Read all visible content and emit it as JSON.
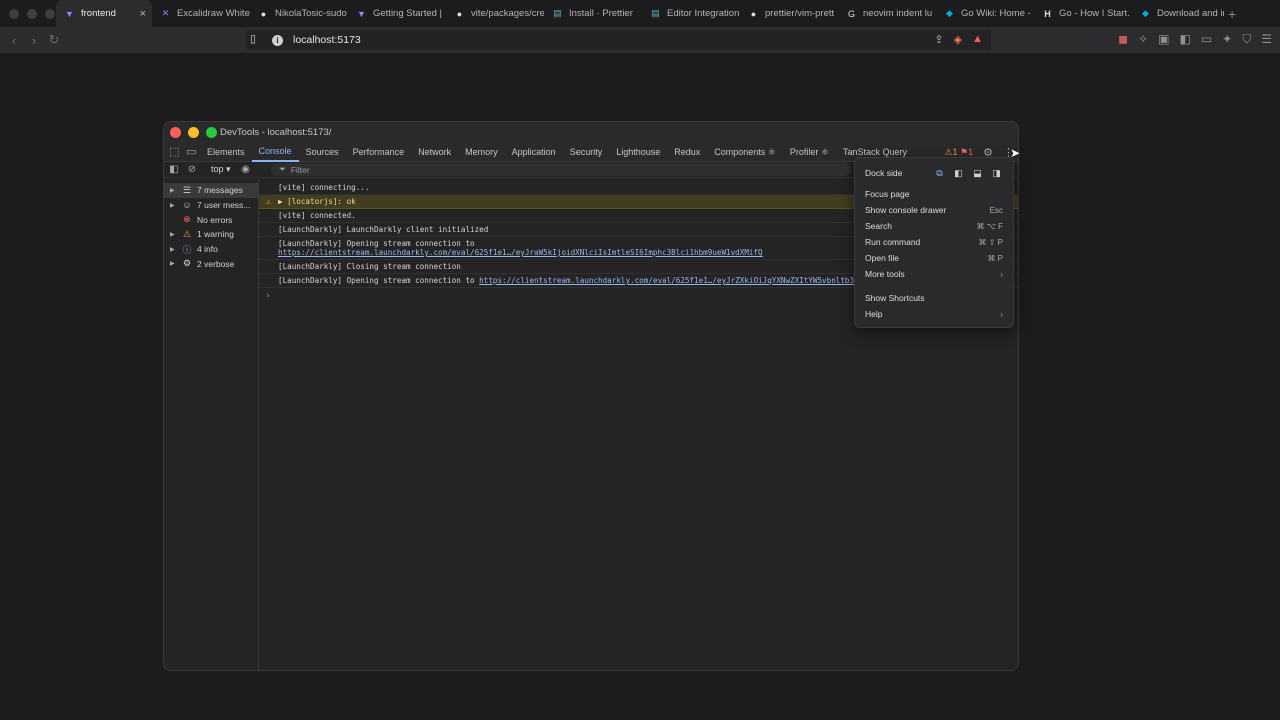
{
  "browser": {
    "tabs": [
      {
        "label": "frontend",
        "icon": "vite-icon",
        "active": true
      },
      {
        "label": "Excalidraw White",
        "icon": "excalidraw-icon"
      },
      {
        "label": "NikolaTosic-sudo",
        "icon": "github-icon"
      },
      {
        "label": "Getting Started |",
        "icon": "vite-icon"
      },
      {
        "label": "vite/packages/cre",
        "icon": "github-icon"
      },
      {
        "label": "Install · Prettier",
        "icon": "prettier-icon"
      },
      {
        "label": "Editor Integration",
        "icon": "prettier-icon"
      },
      {
        "label": "prettier/vim-prett",
        "icon": "github-icon"
      },
      {
        "label": "neovim indent lu",
        "icon": "google-icon"
      },
      {
        "label": "Go Wiki: Home -",
        "icon": "go-icon"
      },
      {
        "label": "Go - How I Start.",
        "icon": "h-icon"
      },
      {
        "label": "Download and in",
        "icon": "go-icon"
      }
    ],
    "url": "localhost:5173"
  },
  "devtools": {
    "title": "DevTools - localhost:5173/",
    "tabs": [
      "Elements",
      "Console",
      "Sources",
      "Performance",
      "Network",
      "Memory",
      "Application",
      "Security",
      "Lighthouse",
      "Redux",
      "Components ⚛",
      "Profiler ⚛",
      "TanStack Query"
    ],
    "active_tab": "Console",
    "warning_count": "1",
    "issue_count": "1",
    "context": "top",
    "filter_placeholder": "Filter",
    "sidebar": [
      {
        "label": "7 messages",
        "icon": "list-icon"
      },
      {
        "label": "7 user mess...",
        "icon": "user-icon"
      },
      {
        "label": "No errors",
        "icon": "error-icon"
      },
      {
        "label": "1 warning",
        "icon": "warning-icon"
      },
      {
        "label": "4 info",
        "icon": "info-icon"
      },
      {
        "label": "2 verbose",
        "icon": "verbose-icon"
      }
    ],
    "messages": [
      {
        "text": "[vite] connecting..."
      },
      {
        "text": "▶ [locatorjs]: ok",
        "level": "warn"
      },
      {
        "text": "[vite] connected."
      },
      {
        "text": "[LaunchDarkly] LaunchDarkly client initialized"
      },
      {
        "text": "[LaunchDarkly] Opening stream connection to",
        "link": "https://clientstream.launchdarkly.com/eval/625f1e1…/eyJraW5kIjoidXNlciIsImtleSI6Imphc3Blci1hbm9ueW1vdXMifQ"
      },
      {
        "text": "[LaunchDarkly] Closing stream connection"
      },
      {
        "text": "[LaunchDarkly] Opening stream connection to ",
        "link_inline": "https://clientstream.launchdarkly.com/eval/625f1e1…/eyJrZXkiOiJqYXNwZXItYW5vbnltb3VzIn0"
      }
    ]
  },
  "menu": {
    "dock_side": "Dock side",
    "items": [
      {
        "label": "Focus page",
        "shortcut": ""
      },
      {
        "label": "Show console drawer",
        "shortcut": "Esc"
      },
      {
        "label": "Search",
        "shortcut": "⌘ ⌥ F"
      },
      {
        "label": "Run command",
        "shortcut": "⌘ ⇧ P"
      },
      {
        "label": "Open file",
        "shortcut": "⌘ P"
      },
      {
        "label": "More tools",
        "shortcut": "›"
      }
    ],
    "items2": [
      {
        "label": "Show Shortcuts",
        "shortcut": ""
      },
      {
        "label": "Help",
        "shortcut": "›"
      }
    ]
  }
}
